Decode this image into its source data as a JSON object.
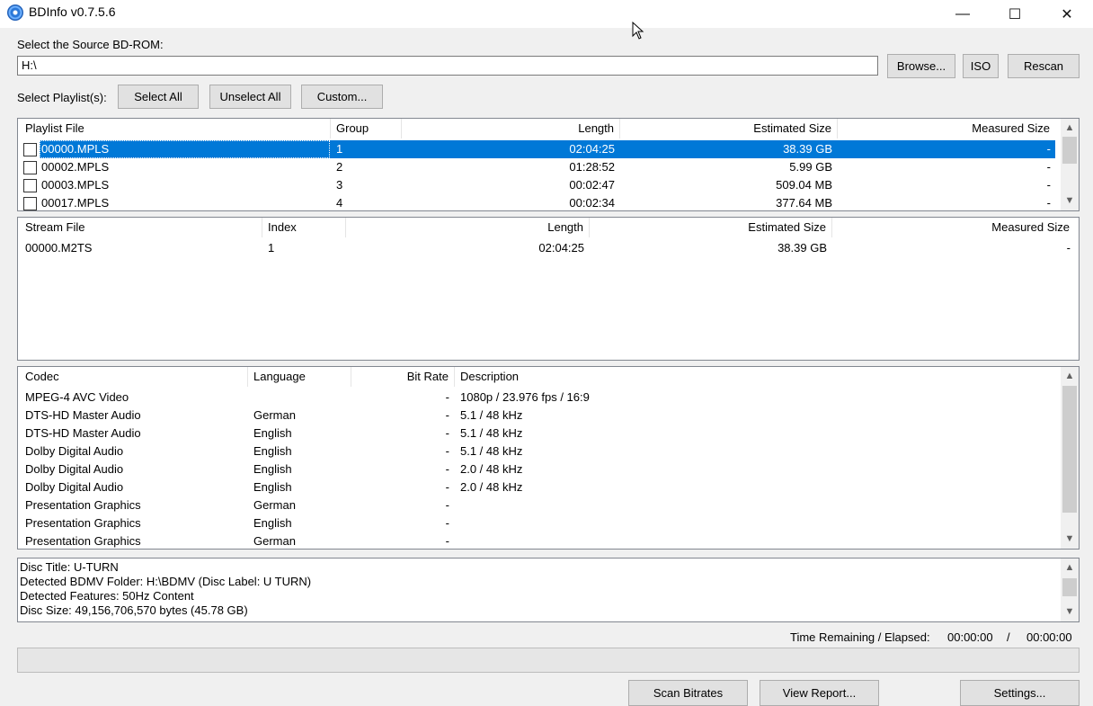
{
  "window": {
    "title": "BDInfo v0.7.5.6",
    "minimize": "—",
    "maximize": "☐",
    "close": "✕"
  },
  "source": {
    "label": "Select the Source BD-ROM:",
    "path": "H:\\",
    "browse": "Browse...",
    "iso": "ISO",
    "rescan": "Rescan"
  },
  "playlist_controls": {
    "label": "Select Playlist(s):",
    "select_all": "Select All",
    "unselect_all": "Unselect All",
    "custom": "Custom..."
  },
  "playlists": {
    "headers": [
      "Playlist File",
      "Group",
      "Length",
      "Estimated Size",
      "Measured Size"
    ],
    "rows": [
      {
        "file": "00000.MPLS",
        "group": "1",
        "length": "02:04:25",
        "est": "38.39 GB",
        "meas": "-",
        "selected": true
      },
      {
        "file": "00002.MPLS",
        "group": "2",
        "length": "01:28:52",
        "est": "5.99 GB",
        "meas": "-"
      },
      {
        "file": "00003.MPLS",
        "group": "3",
        "length": "00:02:47",
        "est": "509.04 MB",
        "meas": "-"
      },
      {
        "file": "00017.MPLS",
        "group": "4",
        "length": "00:02:34",
        "est": "377.64 MB",
        "meas": "-"
      }
    ]
  },
  "streams": {
    "headers": [
      "Stream File",
      "Index",
      "Length",
      "Estimated Size",
      "Measured Size"
    ],
    "rows": [
      {
        "file": "00000.M2TS",
        "index": "1",
        "length": "02:04:25",
        "est": "38.39 GB",
        "meas": "-"
      }
    ]
  },
  "codecs": {
    "headers": [
      "Codec",
      "Language",
      "Bit Rate",
      "Description"
    ],
    "rows": [
      {
        "codec": "MPEG-4 AVC Video",
        "lang": "",
        "rate": "-",
        "desc": "1080p / 23.976 fps / 16:9"
      },
      {
        "codec": "DTS-HD Master Audio",
        "lang": "German",
        "rate": "-",
        "desc": "5.1 / 48 kHz"
      },
      {
        "codec": "DTS-HD Master Audio",
        "lang": "English",
        "rate": "-",
        "desc": "5.1 / 48 kHz"
      },
      {
        "codec": "Dolby Digital Audio",
        "lang": "English",
        "rate": "-",
        "desc": "5.1 / 48 kHz"
      },
      {
        "codec": "Dolby Digital Audio",
        "lang": "English",
        "rate": "-",
        "desc": "2.0 / 48 kHz"
      },
      {
        "codec": "Dolby Digital Audio",
        "lang": "English",
        "rate": "-",
        "desc": "2.0 / 48 kHz"
      },
      {
        "codec": "Presentation Graphics",
        "lang": "German",
        "rate": "-",
        "desc": ""
      },
      {
        "codec": "Presentation Graphics",
        "lang": "English",
        "rate": "-",
        "desc": ""
      },
      {
        "codec": "Presentation Graphics",
        "lang": "German",
        "rate": "-",
        "desc": ""
      }
    ]
  },
  "disc_info": [
    "Disc Title: U-TURN",
    "Detected BDMV Folder: H:\\BDMV (Disc Label: U TURN)",
    "Detected Features: 50Hz Content",
    "Disc Size: 49,156,706,570 bytes (45.78 GB)"
  ],
  "timing": {
    "label": "Time Remaining / Elapsed:",
    "remaining": "00:00:00",
    "separator": "/",
    "elapsed": "00:00:00"
  },
  "progress": {
    "fraction": 0
  },
  "actions": {
    "scan": "Scan Bitrates",
    "report": "View Report...",
    "settings": "Settings..."
  },
  "icons": {
    "scroll_up": "chevron-up-icon",
    "scroll_down": "chevron-down-icon"
  }
}
